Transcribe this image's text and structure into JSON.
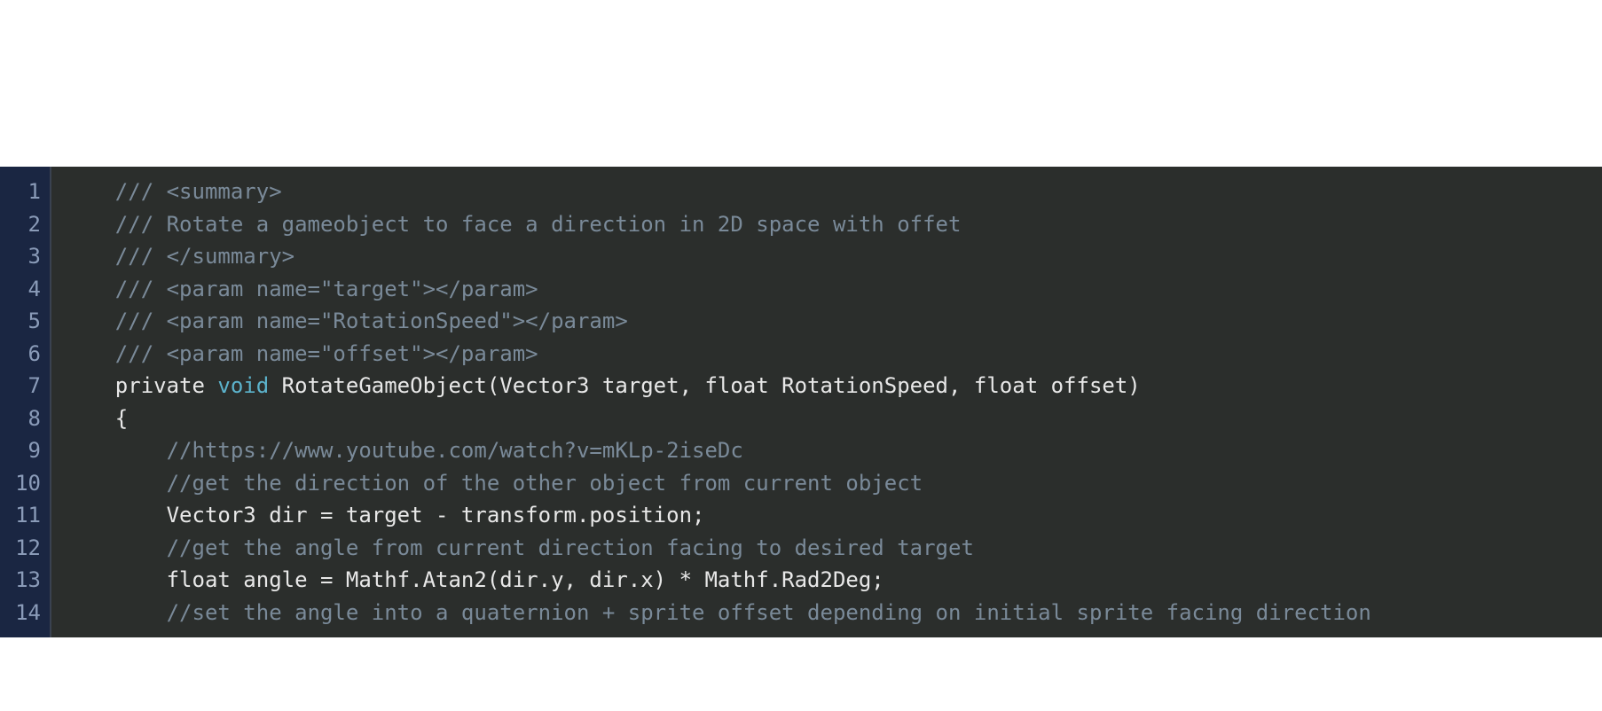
{
  "code": {
    "lines": [
      {
        "num": "1",
        "tokens": [
          {
            "cls": "tok-default",
            "text": "    "
          },
          {
            "cls": "tok-comment",
            "text": "/// <summary>"
          }
        ]
      },
      {
        "num": "2",
        "tokens": [
          {
            "cls": "tok-default",
            "text": "    "
          },
          {
            "cls": "tok-comment",
            "text": "/// Rotate a gameobject to face a direction in 2D space with offet"
          }
        ]
      },
      {
        "num": "3",
        "tokens": [
          {
            "cls": "tok-default",
            "text": "    "
          },
          {
            "cls": "tok-comment",
            "text": "/// </summary>"
          }
        ]
      },
      {
        "num": "4",
        "tokens": [
          {
            "cls": "tok-default",
            "text": "    "
          },
          {
            "cls": "tok-comment",
            "text": "/// <param name=\"target\"></param>"
          }
        ]
      },
      {
        "num": "5",
        "tokens": [
          {
            "cls": "tok-default",
            "text": "    "
          },
          {
            "cls": "tok-comment",
            "text": "/// <param name=\"RotationSpeed\"></param>"
          }
        ]
      },
      {
        "num": "6",
        "tokens": [
          {
            "cls": "tok-default",
            "text": "    "
          },
          {
            "cls": "tok-comment",
            "text": "/// <param name=\"offset\"></param>"
          }
        ]
      },
      {
        "num": "7",
        "tokens": [
          {
            "cls": "tok-default",
            "text": "    private "
          },
          {
            "cls": "tok-keyword",
            "text": "void"
          },
          {
            "cls": "tok-default",
            "text": " RotateGameObject(Vector3 target, float RotationSpeed, float offset)"
          }
        ]
      },
      {
        "num": "8",
        "tokens": [
          {
            "cls": "tok-default",
            "text": "    {"
          }
        ]
      },
      {
        "num": "9",
        "tokens": [
          {
            "cls": "tok-default",
            "text": "        "
          },
          {
            "cls": "tok-comment",
            "text": "//https://www.youtube.com/watch?v=mKLp-2iseDc"
          }
        ]
      },
      {
        "num": "10",
        "tokens": [
          {
            "cls": "tok-default",
            "text": "        "
          },
          {
            "cls": "tok-comment",
            "text": "//get the direction of the other object from current object"
          }
        ]
      },
      {
        "num": "11",
        "tokens": [
          {
            "cls": "tok-default",
            "text": "        Vector3 dir = target - transform.position;"
          }
        ]
      },
      {
        "num": "12",
        "tokens": [
          {
            "cls": "tok-default",
            "text": "        "
          },
          {
            "cls": "tok-comment",
            "text": "//get the angle from current direction facing to desired target"
          }
        ]
      },
      {
        "num": "13",
        "tokens": [
          {
            "cls": "tok-default",
            "text": "        float angle = Mathf.Atan2(dir.y, dir.x) * Mathf.Rad2Deg;"
          }
        ]
      },
      {
        "num": "14",
        "tokens": [
          {
            "cls": "tok-default",
            "text": "        "
          },
          {
            "cls": "tok-comment",
            "text": "//set the angle into a quaternion + sprite offset depending on initial sprite facing direction"
          }
        ]
      }
    ]
  }
}
